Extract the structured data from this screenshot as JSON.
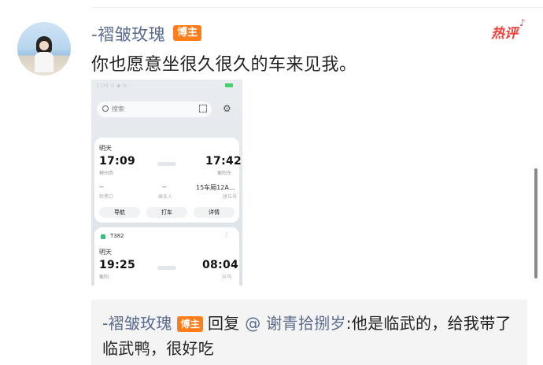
{
  "post": {
    "author": "-褶皱玫瑰",
    "author_badge": "博主",
    "hot_tag": "热评",
    "comment": "你也愿意坐很久很久的车来见我。"
  },
  "screenshot": {
    "search_placeholder": "搜索",
    "card1": {
      "date": "明天",
      "depart_time": "17:09",
      "depart_station": "郴州西",
      "arrive_time": "17:42",
      "arrive_station": "衡阳东",
      "gate_value": "--",
      "gate_label": "检票口",
      "passenger_value": "--",
      "passenger_label": "乘车人",
      "seat_value": "15车厢12A…",
      "seat_label": "座位号",
      "btn_nav": "导航",
      "btn_taxi": "打车",
      "btn_detail": "详情"
    },
    "card2": {
      "train_no": "T382",
      "date": "明天",
      "depart_time": "19:25",
      "depart_station": "衡阳",
      "arrive_time": "08:04",
      "arrive_station": "义乌"
    }
  },
  "reply": {
    "author": "-褶皱玫瑰",
    "author_badge": "博主",
    "verb": "回复",
    "mention": "@ 谢青拾捌岁",
    "text": ":他是临武的，给我带了临武鸭，很好吃"
  },
  "icons": {
    "avatar": "user-avatar-photo",
    "search": "search-icon",
    "scan": "scan-icon",
    "settings": "gear-icon",
    "train": "train-icon"
  },
  "colors": {
    "username": "#5b6c8f",
    "badge": "#ff7d1a",
    "hot": "#f1403c"
  }
}
